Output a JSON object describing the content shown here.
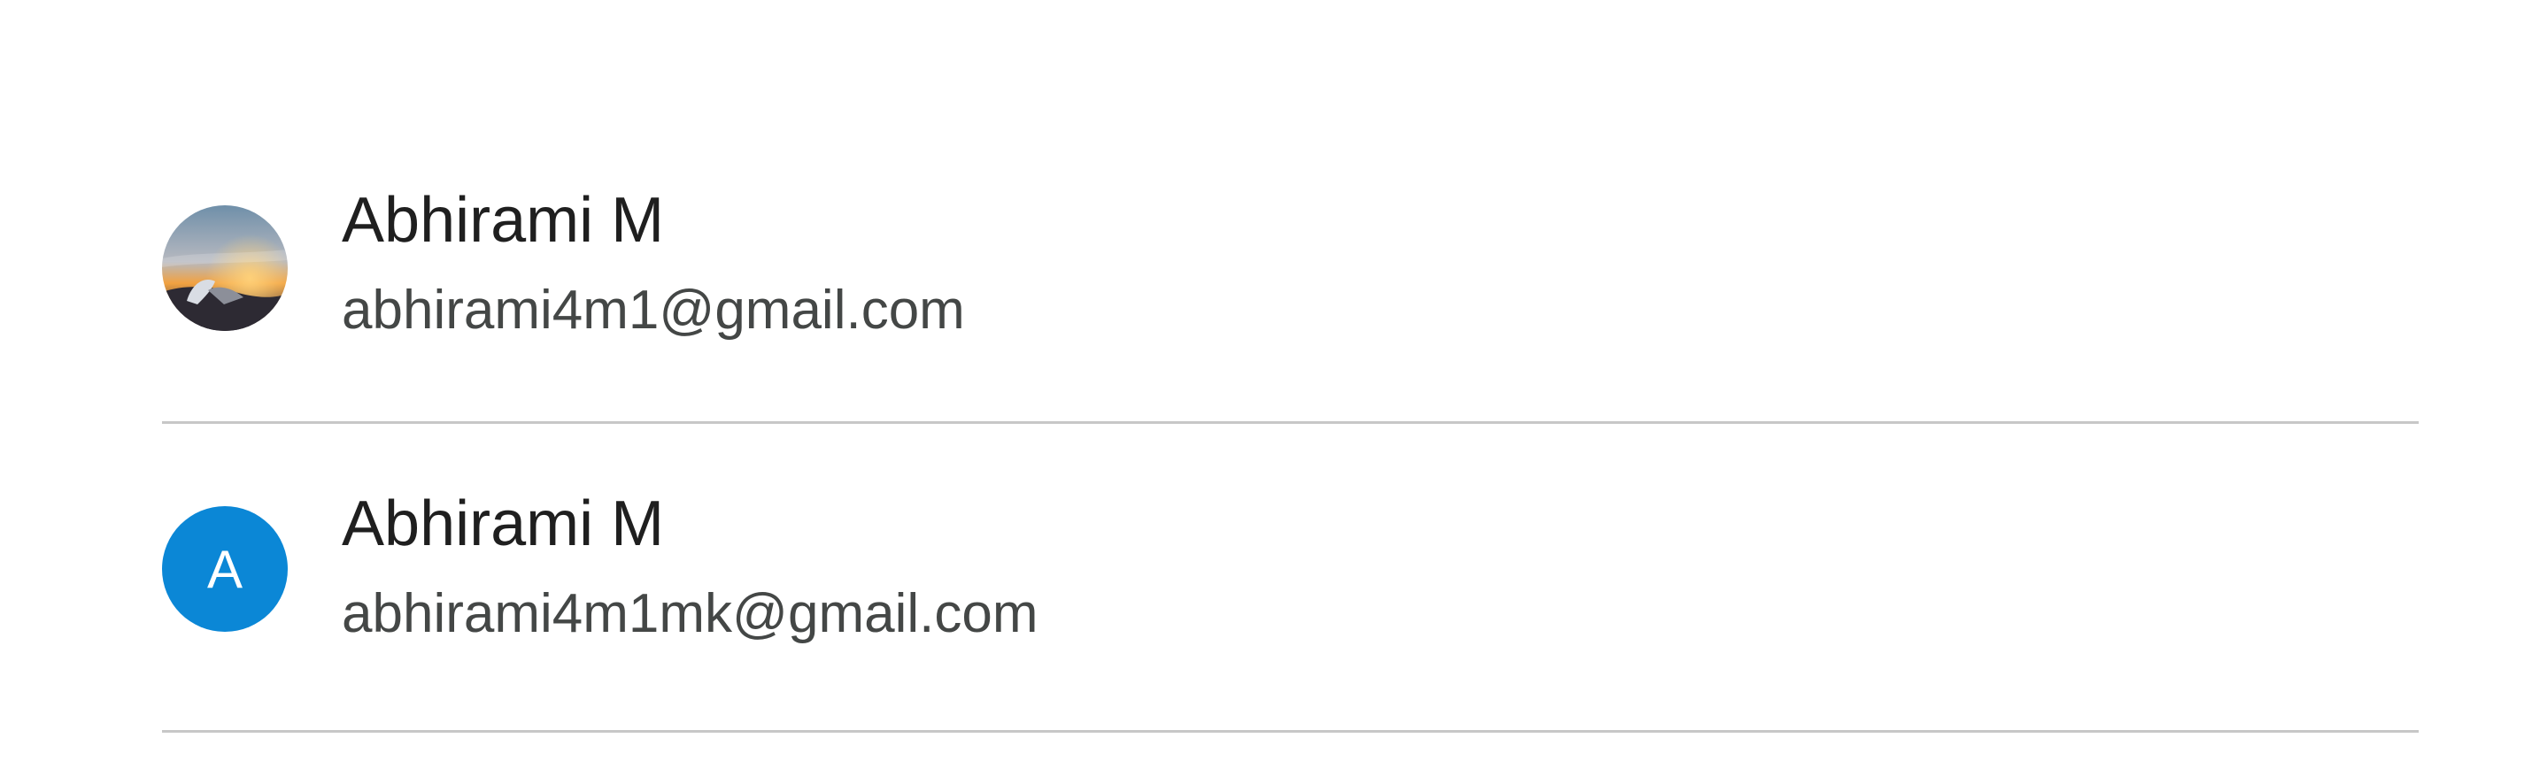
{
  "accounts": [
    {
      "name": "Abhirami M",
      "email": "abhirami4m1@gmail.com",
      "avatar": {
        "type": "photo",
        "icon": "profile-photo"
      }
    },
    {
      "name": "Abhirami M",
      "email": "abhirami4m1mk@gmail.com",
      "avatar": {
        "type": "letter",
        "letter": "A",
        "color": "#0b87d6"
      }
    }
  ],
  "colors": {
    "name_text": "#1f1f1f",
    "email_text": "#444746",
    "divider": "#c7c7c7",
    "letter_avatar_bg": "#0b87d6"
  }
}
